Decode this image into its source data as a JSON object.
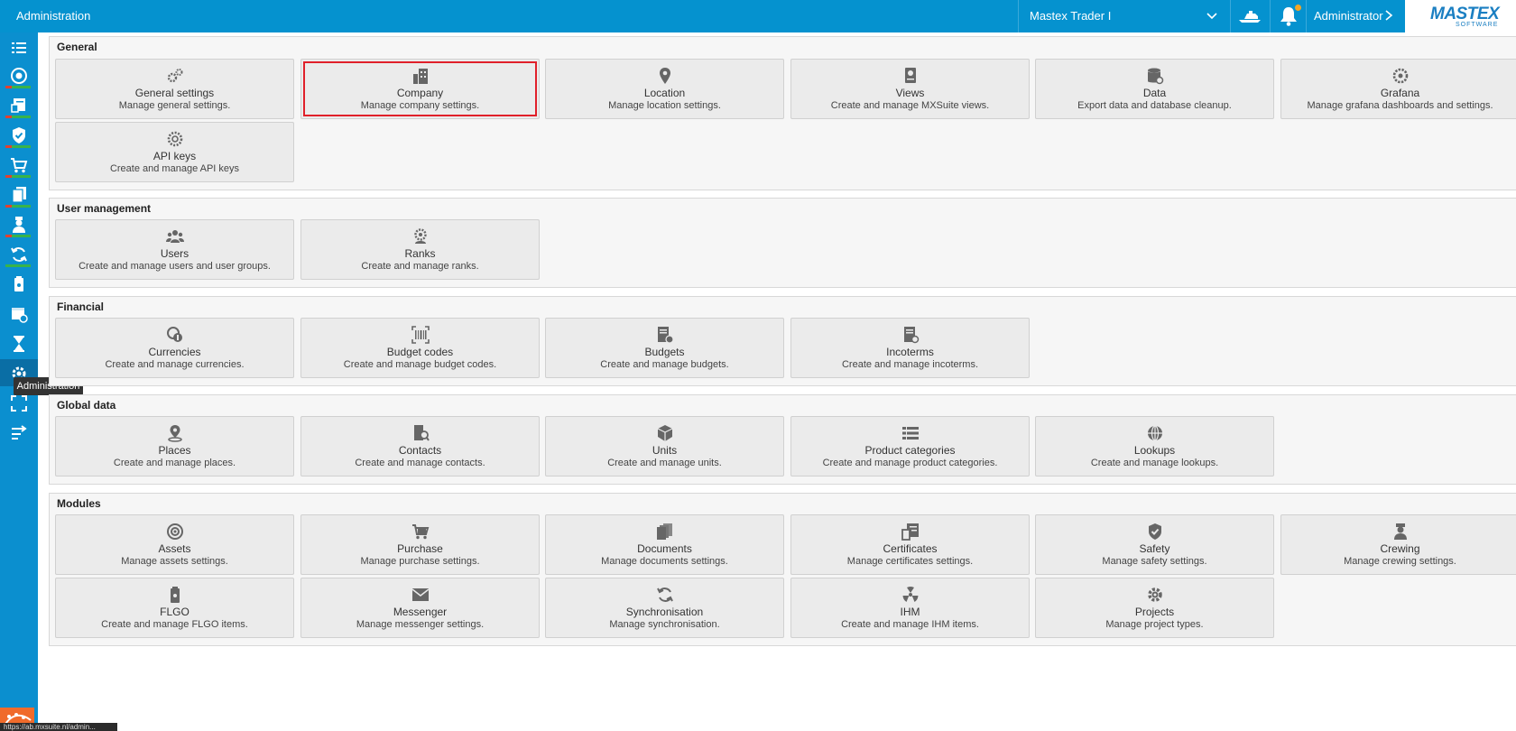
{
  "header": {
    "title": "Administration",
    "vessel": "Mastex Trader I",
    "user": "Administrator",
    "brand_main": "MASTEX",
    "brand_sub": "SOFTWARE",
    "notification_color": "#f5a623"
  },
  "sidebar": {
    "tooltip": "Administration",
    "url_status": "https://ab.mxsuite.nl/admin...",
    "items": [
      {
        "icon": "list-icon"
      },
      {
        "icon": "assets-icon"
      },
      {
        "icon": "certificates-icon"
      },
      {
        "icon": "safety-icon"
      },
      {
        "icon": "purchase-icon"
      },
      {
        "icon": "documents-icon"
      },
      {
        "icon": "crewing-icon"
      },
      {
        "icon": "sync-icon"
      },
      {
        "icon": "flgo-icon"
      },
      {
        "icon": "calendar-icon"
      },
      {
        "icon": "hourglass-icon"
      },
      {
        "icon": "administration-icon"
      },
      {
        "icon": "fullscreen-icon"
      },
      {
        "icon": "transfer-icon"
      }
    ]
  },
  "sections": [
    {
      "title": "General",
      "tiles": [
        {
          "name": "General settings",
          "desc": "Manage general settings.",
          "icon": "gears-icon"
        },
        {
          "name": "Company",
          "desc": "Manage company settings.",
          "icon": "company-icon"
        },
        {
          "name": "Location",
          "desc": "Manage location settings.",
          "icon": "location-pin-icon"
        },
        {
          "name": "Views",
          "desc": "Create and manage MXSuite views.",
          "icon": "views-icon"
        },
        {
          "name": "Data",
          "desc": "Export data and database cleanup.",
          "icon": "database-icon"
        },
        {
          "name": "Grafana",
          "desc": "Manage grafana dashboards and settings.",
          "icon": "grafana-icon"
        },
        {
          "name": "API keys",
          "desc": "Create and manage API keys",
          "icon": "api-keys-icon"
        }
      ]
    },
    {
      "title": "User management",
      "tiles": [
        {
          "name": "Users",
          "desc": "Create and manage users and user groups.",
          "icon": "users-icon"
        },
        {
          "name": "Ranks",
          "desc": "Create and manage ranks.",
          "icon": "ranks-icon"
        }
      ]
    },
    {
      "title": "Financial",
      "tiles": [
        {
          "name": "Currencies",
          "desc": "Create and manage currencies.",
          "icon": "currencies-icon"
        },
        {
          "name": "Budget codes",
          "desc": "Create and manage budget codes.",
          "icon": "budget-codes-icon"
        },
        {
          "name": "Budgets",
          "desc": "Create and manage budgets.",
          "icon": "budgets-icon"
        },
        {
          "name": "Incoterms",
          "desc": "Create and manage incoterms.",
          "icon": "incoterms-icon"
        }
      ]
    },
    {
      "title": "Global data",
      "tiles": [
        {
          "name": "Places",
          "desc": "Create and manage places.",
          "icon": "places-icon"
        },
        {
          "name": "Contacts",
          "desc": "Create and manage contacts.",
          "icon": "contacts-icon"
        },
        {
          "name": "Units",
          "desc": "Create and manage units.",
          "icon": "units-icon"
        },
        {
          "name": "Product categories",
          "desc": "Create and manage product categories.",
          "icon": "product-categories-icon"
        },
        {
          "name": "Lookups",
          "desc": "Create and manage lookups.",
          "icon": "lookups-icon"
        }
      ]
    },
    {
      "title": "Modules",
      "tiles": [
        {
          "name": "Assets",
          "desc": "Manage assets settings.",
          "icon": "assets-icon"
        },
        {
          "name": "Purchase",
          "desc": "Manage purchase settings.",
          "icon": "purchase-icon"
        },
        {
          "name": "Documents",
          "desc": "Manage documents settings.",
          "icon": "documents-icon"
        },
        {
          "name": "Certificates",
          "desc": "Manage certificates settings.",
          "icon": "certificates-icon"
        },
        {
          "name": "Safety",
          "desc": "Manage safety settings.",
          "icon": "safety-icon"
        },
        {
          "name": "Crewing",
          "desc": "Manage crewing settings.",
          "icon": "crewing-icon"
        },
        {
          "name": "FLGO",
          "desc": "Create and manage FLGO items.",
          "icon": "flgo-icon"
        },
        {
          "name": "Messenger",
          "desc": "Manage messenger settings.",
          "icon": "envelope-icon"
        },
        {
          "name": "Synchronisation",
          "desc": "Manage synchronisation.",
          "icon": "sync-icon"
        },
        {
          "name": "IHM",
          "desc": "Create and manage IHM items.",
          "icon": "ihm-icon"
        },
        {
          "name": "Projects",
          "desc": "Manage project types.",
          "icon": "gear-icon"
        }
      ]
    }
  ]
}
